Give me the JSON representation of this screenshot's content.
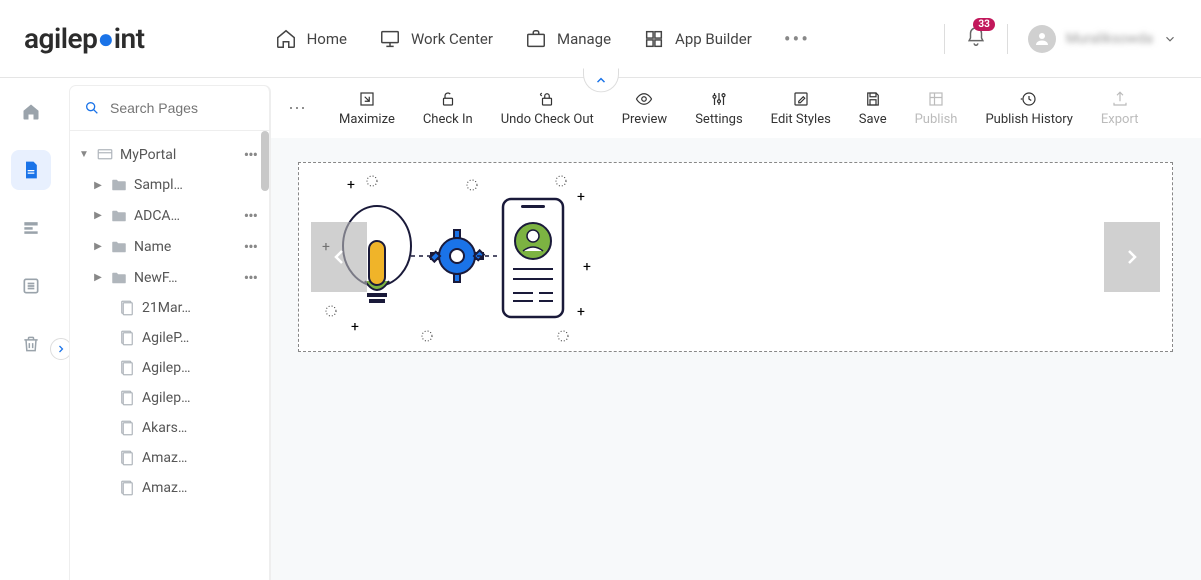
{
  "brand": {
    "name_a": "agilep",
    "name_b": "int"
  },
  "nav": {
    "home": "Home",
    "work_center": "Work Center",
    "manage": "Manage",
    "app_builder": "App Builder"
  },
  "notifications": {
    "count": "33"
  },
  "user": {
    "display_name": "Muraliksowda"
  },
  "search": {
    "placeholder": "Search Pages"
  },
  "tree": {
    "root": {
      "label": "MyPortal",
      "has_menu": true
    },
    "folders": [
      {
        "label": "Sampl…",
        "has_menu": false
      },
      {
        "label": "ADCA…",
        "has_menu": true
      },
      {
        "label": "Name",
        "has_menu": true
      },
      {
        "label": "NewF…",
        "has_menu": true
      }
    ],
    "pages": [
      {
        "label": "21Mar…"
      },
      {
        "label": "AgileP…"
      },
      {
        "label": "Agilep…"
      },
      {
        "label": "Agilep…"
      },
      {
        "label": "Akars…"
      },
      {
        "label": "Amaz…"
      },
      {
        "label": "Amaz…"
      }
    ]
  },
  "toolbar": {
    "maximize": "Maximize",
    "check_in": "Check In",
    "undo_check_out": "Undo Check Out",
    "preview": "Preview",
    "settings": "Settings",
    "edit_styles": "Edit Styles",
    "save": "Save",
    "publish": "Publish",
    "publish_history": "Publish History",
    "export": "Export"
  }
}
